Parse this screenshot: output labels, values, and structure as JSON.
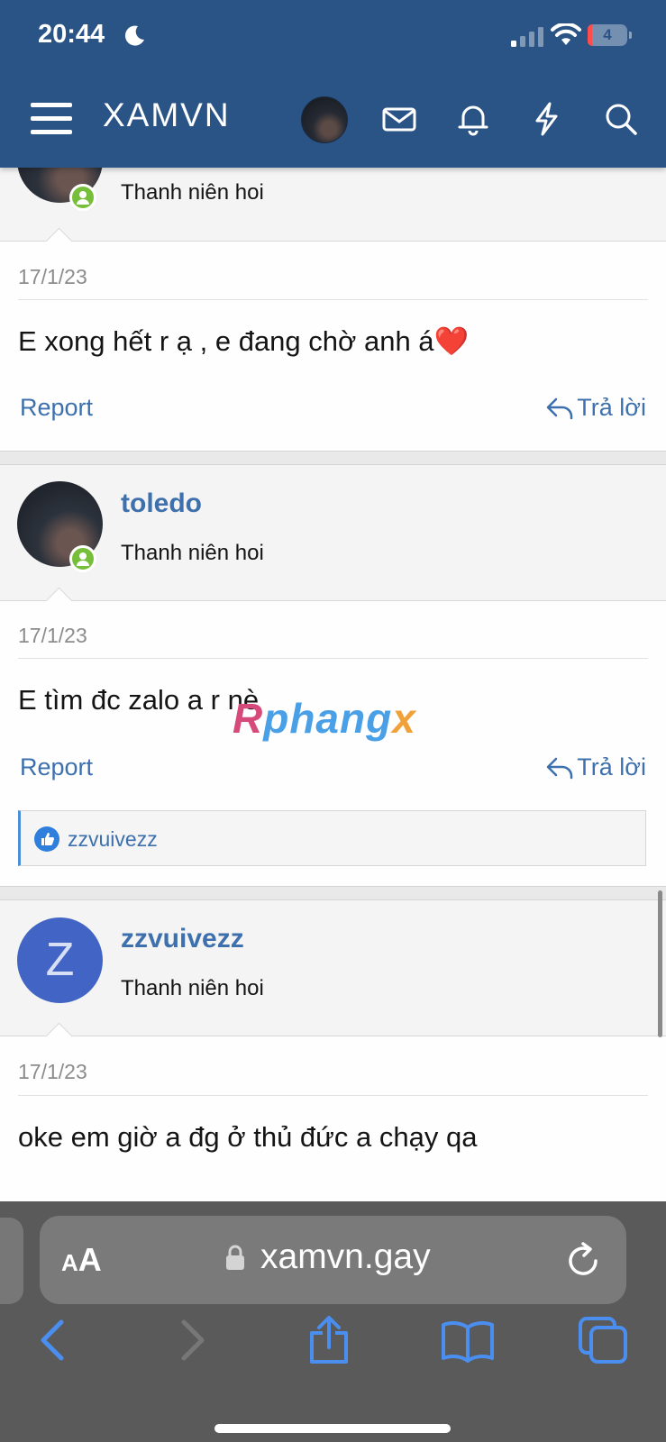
{
  "status_bar": {
    "time": "20:44",
    "battery": "4",
    "battery_level": 0.04
  },
  "header": {
    "logo": "XAMVN",
    "icons": [
      "menu-icon",
      "avatar",
      "envelope-icon",
      "bell-icon",
      "lightning-icon",
      "search-icon"
    ]
  },
  "posts": [
    {
      "title": "Thanh niên hoi",
      "date": "17/1/23",
      "message": "E xong hết r ạ , e đang chờ anh á❤️",
      "report": "Report",
      "reply": "Trả lời"
    },
    {
      "username": "toledo",
      "title": "Thanh niên hoi",
      "date": "17/1/23",
      "message": "E tìm đc zalo a r nè",
      "report": "Report",
      "reply": "Trả lời",
      "liked_by": "zzvuivezz"
    },
    {
      "username": "zzvuivezz",
      "avatar_letter": "Z",
      "title": "Thanh niên hoi",
      "date": "17/1/23",
      "message": "oke em giờ a đg ở thủ đức a chạy qa"
    }
  ],
  "watermark": {
    "part1": "R",
    "part2": "phang",
    "part3": "x"
  },
  "browser": {
    "text_size_label_small": "A",
    "text_size_label_large": "A",
    "url": "xamvn.gay"
  },
  "colors": {
    "header_bg": "#2b5486",
    "link": "#3d70ad",
    "online": "#77bf3b"
  }
}
